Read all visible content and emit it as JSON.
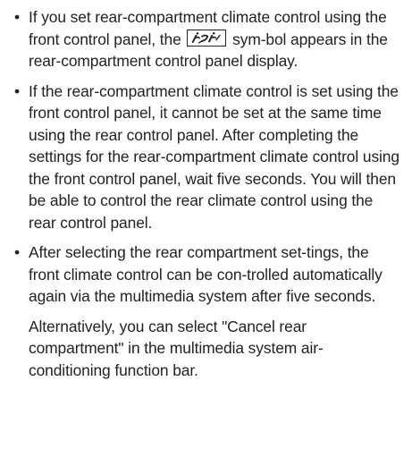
{
  "bullets": [
    {
      "paragraphs": [
        {
          "before_symbol": "If you set rear-compartment climate control using the front control panel, the",
          "symbol_icon": "rear-climate-control-symbol",
          "after_symbol": "sym-bol appears in the rear-compartment control panel display."
        }
      ]
    },
    {
      "paragraphs": [
        {
          "text": "If the rear-compartment climate control is set using the front control panel, it cannot be set at the same time using the rear control panel. After completing the settings for the rear-compartment climate control using the front control panel, wait five seconds. You will then be able to control the rear climate control using the rear control panel."
        }
      ]
    },
    {
      "paragraphs": [
        {
          "text": "After selecting the rear compartment set-tings, the front climate control can be con-trolled automatically again via the multimedia system after five seconds."
        },
        {
          "text": "Alternatively, you can select \"Cancel rear compartment\" in the multimedia system air-conditioning function bar."
        }
      ]
    }
  ],
  "bullet_glyph": "•"
}
